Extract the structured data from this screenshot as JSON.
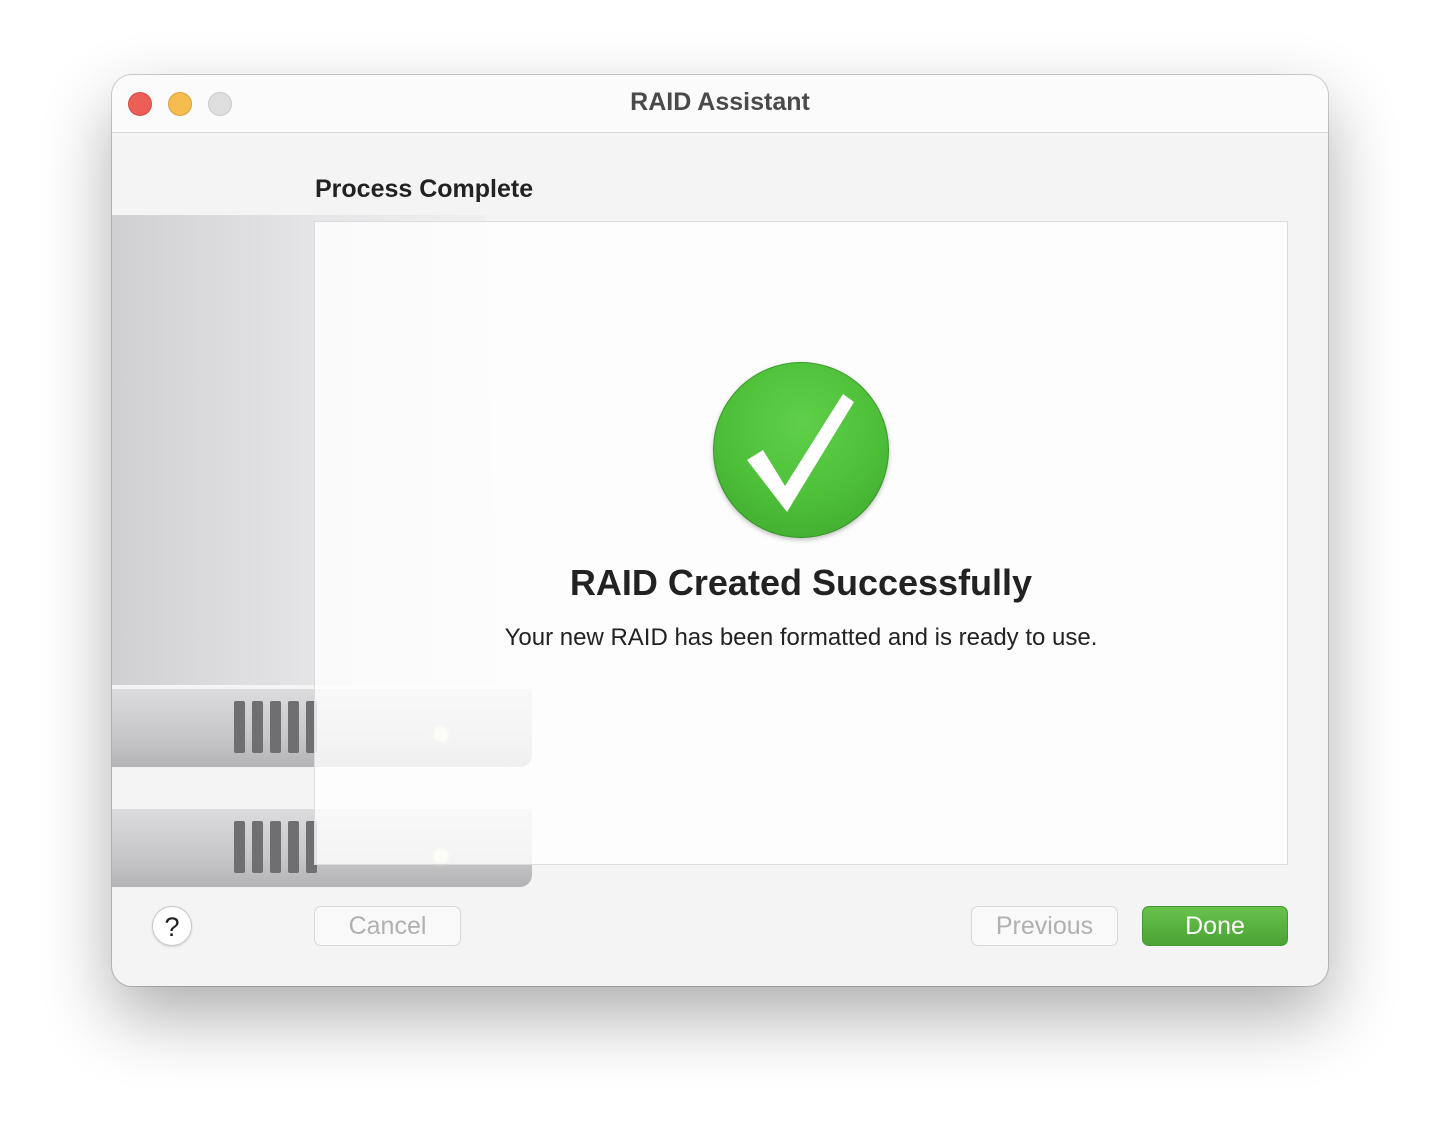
{
  "window": {
    "title": "RAID Assistant"
  },
  "page": {
    "section_title": "Process Complete"
  },
  "result": {
    "headline": "RAID Created Successfully",
    "message": "Your new RAID has been formatted and is ready to use.",
    "icon": "checkmark-circle-icon",
    "icon_color": "#4cbe38"
  },
  "buttons": {
    "help": "?",
    "cancel": "Cancel",
    "previous": "Previous",
    "done": "Done",
    "done_color": "#58b13f"
  }
}
